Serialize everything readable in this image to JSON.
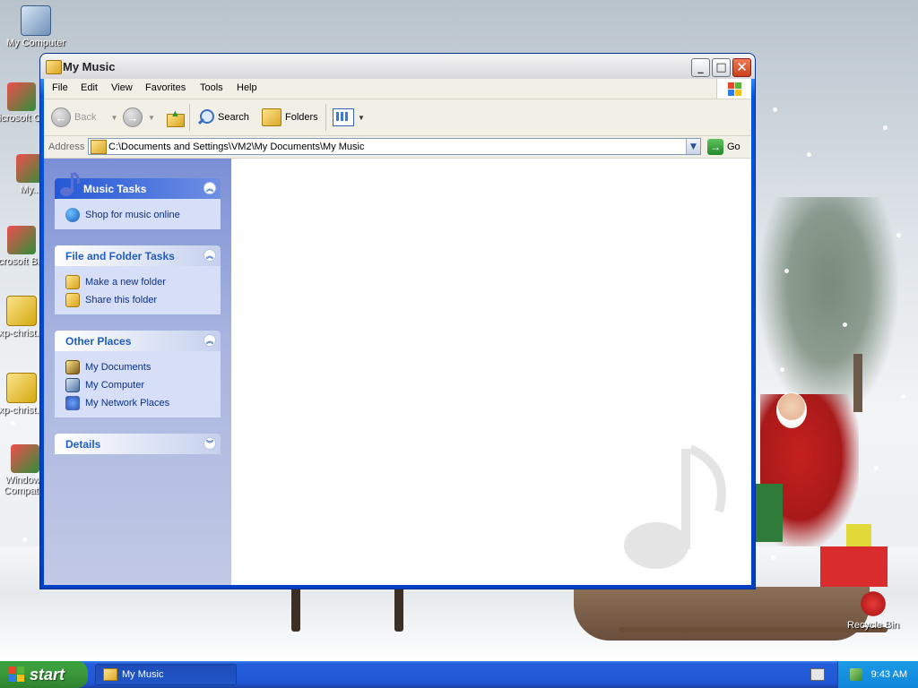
{
  "desktop": {
    "icons": [
      {
        "label": "My Computer"
      },
      {
        "label": "Microsoft C++"
      },
      {
        "label": "My..."
      },
      {
        "label": "Microsoft Basic"
      },
      {
        "label": "xp-christ..."
      },
      {
        "label": "xp-christ..."
      },
      {
        "label": "Windows Compat..."
      },
      {
        "label": "Recycle Bin"
      }
    ]
  },
  "window": {
    "title": "My Music",
    "menu": [
      "File",
      "Edit",
      "View",
      "Favorites",
      "Tools",
      "Help"
    ],
    "toolbar": {
      "back_label": "Back",
      "search_label": "Search",
      "folders_label": "Folders"
    },
    "address": {
      "label": "Address",
      "value": "C:\\Documents and Settings\\VM2\\My Documents\\My Music",
      "go_label": "Go"
    },
    "taskpane": {
      "music_tasks": {
        "title": "Music Tasks",
        "items": [
          "Shop for music online"
        ]
      },
      "file_folder_tasks": {
        "title": "File and Folder Tasks",
        "items": [
          "Make a new folder",
          "Share this folder"
        ]
      },
      "other_places": {
        "title": "Other Places",
        "items": [
          "My Documents",
          "My Computer",
          "My Network Places"
        ]
      },
      "details": {
        "title": "Details"
      }
    }
  },
  "taskbar": {
    "start_label": "start",
    "task_item": "My Music",
    "clock": "9:43 AM"
  },
  "colors": {
    "titlebar_text": "#222222",
    "taskpane_link": "#0c2f8c",
    "panel_title": "#215dc6",
    "start_green": "#3c9a3c",
    "taskbar_blue": "#2157d6"
  }
}
